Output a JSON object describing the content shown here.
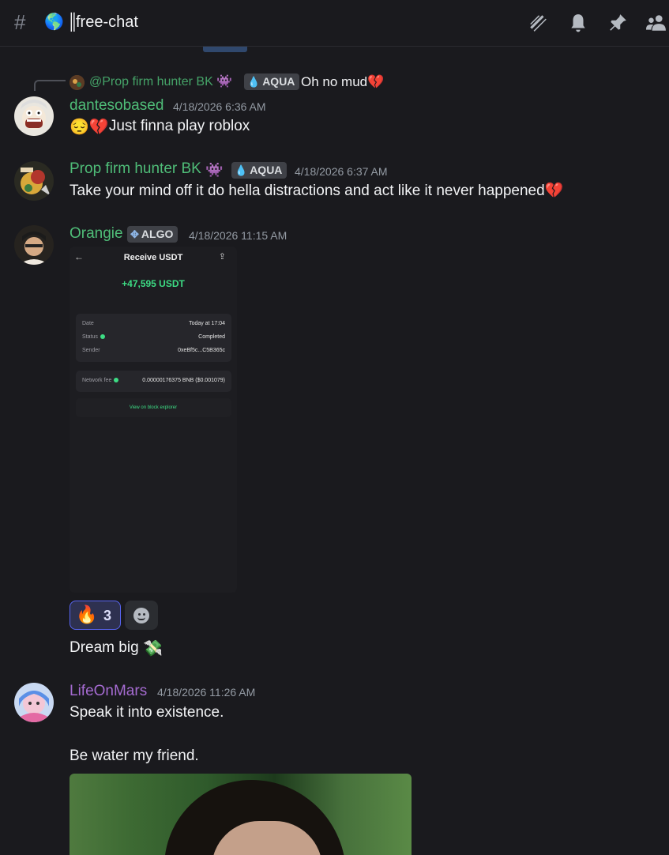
{
  "header": {
    "channel_emoji": "🌎",
    "channel_divider": "║",
    "channel_name": "free-chat",
    "icons": [
      "threads-icon",
      "bell-icon",
      "pin-icon",
      "members-icon"
    ]
  },
  "messages": [
    {
      "reply": {
        "name": "@Prop firm hunter BK 👾",
        "tag": "AQUA",
        "text": "Oh no mud💔"
      },
      "username": "dantesobased",
      "username_color": "#4fbd78",
      "timestamp": "4/18/2026 6:36 AM",
      "text_emoji": "😔💔",
      "text": "Just finna play roblox"
    },
    {
      "username": "Prop firm hunter BK",
      "username_emoji": "👾",
      "username_color": "#4fbd78",
      "tag": "AQUA",
      "timestamp": "4/18/2026 6:37 AM",
      "text": "Take your mind off it do hella distractions and act like it never happened💔"
    },
    {
      "username": "Orangie",
      "username_color": "#4fbd78",
      "tag": "ALGO",
      "timestamp": "4/18/2026 11:15 AM",
      "attachment": {
        "title": "Receive USDT",
        "amount": "+47,595 USDT",
        "rows": [
          {
            "label": "Date",
            "value": "Today at 17:04"
          },
          {
            "label": "Status",
            "value": "Completed"
          },
          {
            "label": "Sender",
            "value": "0xeBf5c...C5B365c"
          }
        ],
        "fee_label": "Network fee",
        "fee_value": "0.00000176375 BNB ($0.001079)",
        "link": "View on block explorer"
      },
      "reaction": {
        "emoji": "🔥",
        "count": "3"
      },
      "followup_text": "Dream big",
      "followup_emoji": "💸"
    },
    {
      "username": "LifeOnMars",
      "username_color": "#a56bd1",
      "timestamp": "4/18/2026 11:26 AM",
      "text": "Speak it into existence.",
      "text2": "Be water my friend."
    }
  ]
}
